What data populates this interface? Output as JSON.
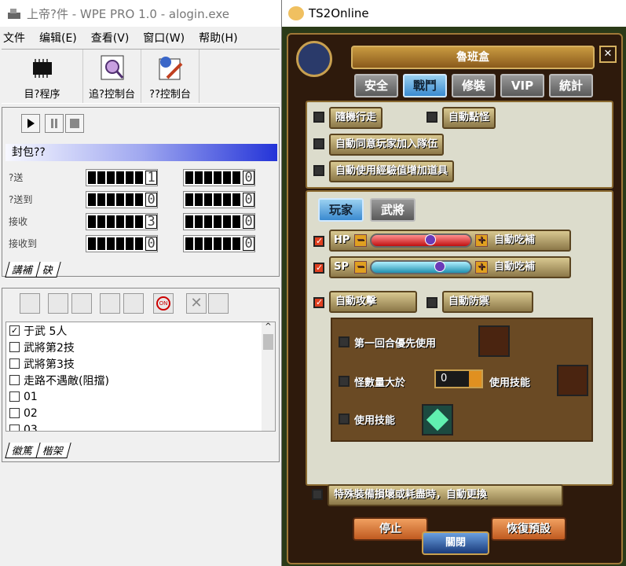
{
  "left_window": {
    "title": "上帝?件 - WPE PRO 1.0 - alogin.exe",
    "menu": [
      "文件",
      "编辑(E)",
      "查看(V)",
      "窗口(W)",
      "帮助(H)"
    ],
    "toolbar": {
      "target_label": "目?程序",
      "log_console_label": "追?控制台",
      "send_console_label": "??控制台"
    },
    "packet_header": "封包??",
    "rows": [
      {
        "label": "?送",
        "v1": "1",
        "v2": "0"
      },
      {
        "label": "?送到",
        "v1": "0",
        "v2": "0"
      },
      {
        "label": "接收",
        "v1": "3",
        "v2": "0"
      },
      {
        "label": "接收到",
        "v1": "0",
        "v2": "0"
      }
    ],
    "tabs1": [
      "講補",
      "砄"
    ],
    "filter_items": [
      {
        "label": "于武 5人",
        "checked": true
      },
      {
        "label": "武將第2技",
        "checked": false
      },
      {
        "label": "武將第3技",
        "checked": false
      },
      {
        "label": "走路不遇敵(阻擋)",
        "checked": false
      },
      {
        "label": "01",
        "checked": false
      },
      {
        "label": "02",
        "checked": false
      },
      {
        "label": "03",
        "checked": false
      }
    ],
    "tabs2": [
      "徽篤",
      "楷架"
    ],
    "toggle_icon_text": "ON"
  },
  "right_window": {
    "title": "TS2Online",
    "game_title": "魯班盒",
    "tabs": [
      "安全",
      "戰鬥",
      "修裝",
      "VIP",
      "統計"
    ],
    "active_tab": "戰鬥",
    "checks": [
      "隨機行走",
      "自動點怪",
      "自動同意玩家加入隊伍",
      "自動使用經驗值增加道具"
    ],
    "subtabs": [
      "玩家",
      "武將"
    ],
    "hp_label": "HP",
    "sp_label": "SP",
    "auto_eat": "自動吃補",
    "auto_attack": "自動攻擊",
    "auto_defend": "自動防禦",
    "first_round": "第一回合優先使用",
    "monster_count": "怪數量大於",
    "monster_value": "0",
    "use_skill_label": "使用技能",
    "use_skill": "使用技能",
    "equip_swap": "特殊裝備損壞或耗盡時，自動更換",
    "stop": "停止",
    "restore": "恢復預設",
    "close": "關閉",
    "colors": {
      "hp": "#e03030",
      "sp": "#40c0e0"
    }
  }
}
